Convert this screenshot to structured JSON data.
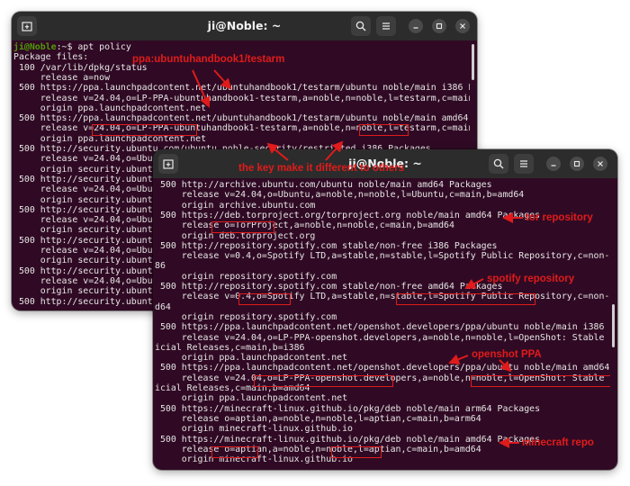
{
  "back_window": {
    "title": "ji@Noble: ~",
    "prompt_user": "ji@Noble",
    "prompt_sep": ":~$",
    "command": " apt policy",
    "lines": [
      "Package files:",
      " 100 /var/lib/dpkg/status",
      "     release a=now",
      " 500 https://ppa.launchpadcontent.net/ubuntuhandbook1/testarm/ubuntu noble/main i386 Packages",
      "     release v=24.04,o=LP-PPA-ubuntuhandbook1-testarm,a=noble,n=noble,l=testarm,c=main,b=i386",
      "     origin ppa.launchpadcontent.net",
      " 500 https://ppa.launchpadcontent.net/ubuntuhandbook1/testarm/ubuntu noble/main amd64 Packages",
      "     release v=24.04,o=LP-PPA-ubuntuhandbook1-testarm,a=noble,n=noble,l=testarm,c=main,b=amd64",
      "     origin ppa.launchpadcontent.net",
      " 500 http://security.ubuntu.com/ubuntu noble-security/restricted i386 Packages",
      "     release v=24.04,o=Ubuntu",
      "     origin security.ubuntu.c",
      " 500 http://security.ubuntu.c",
      "     release v=24.04,o=Ubuntu",
      "     origin security.ubuntu.c",
      " 500 http://security.ubuntu.c",
      "     release v=24.04,o=Ubuntu",
      "     origin security.ubuntu.c",
      " 500 http://security.ubuntu.c",
      "     release v=24.04,o=Ubuntu",
      "     origin security.ubuntu.c",
      " 500 http://security.ubuntu.c",
      "     release v=24.04,o=Ubuntu",
      "     origin security.ubuntu.c",
      " 500 http://security.ubuntu.c"
    ]
  },
  "front_window": {
    "title": "ji@Noble: ~",
    "lines": [
      " 500 http://archive.ubuntu.com/ubuntu noble/main amd64 Packages",
      "     release v=24.04,o=Ubuntu,a=noble,n=noble,l=Ubuntu,c=main,b=amd64",
      "     origin archive.ubuntu.com",
      " 500 https://deb.torproject.org/torproject.org noble/main amd64 Packages",
      "     release o=TorProject,a=noble,n=noble,c=main,b=amd64",
      "     origin deb.torproject.org",
      " 500 http://repository.spotify.com stable/non-free i386 Packages",
      "     release v=0.4,o=Spotify LTD,a=stable,n=stable,l=Spotify Public Repository,c=non-free,b=i3",
      "86",
      "     origin repository.spotify.com",
      " 500 http://repository.spotify.com stable/non-free amd64 Packages",
      "     release v=0.4,o=Spotify LTD,a=stable,n=stable,l=Spotify Public Repository,c=non-free,b=am",
      "d64",
      "     origin repository.spotify.com",
      " 500 https://ppa.launchpadcontent.net/openshot.developers/ppa/ubuntu noble/main i386 Packages",
      "     release v=24.04,o=LP-PPA-openshot.developers,a=noble,n=noble,l=OpenShot: Stable PPA - Off",
      "icial Releases,c=main,b=i386",
      "     origin ppa.launchpadcontent.net",
      " 500 https://ppa.launchpadcontent.net/openshot.developers/ppa/ubuntu noble/main amd64 Packages",
      "     release v=24.04,o=LP-PPA-openshot.developers,a=noble,n=noble,l=OpenShot: Stable PPA - Off",
      "icial Releases,c=main,b=amd64",
      "     origin ppa.launchpadcontent.net",
      " 500 https://minecraft-linux.github.io/pkg/deb noble/main arm64 Packages",
      "     release o=aptian,a=noble,n=noble,l=aptian,c=main,b=arm64",
      "     origin minecraft-linux.github.io",
      " 500 https://minecraft-linux.github.io/pkg/deb noble/main amd64 Packages",
      "     release o=aptian,a=noble,n=noble,l=aptian,c=main,b=amd64",
      "     origin minecraft-linux.github.io"
    ]
  },
  "annotations": {
    "ppa_label": "ppa:ubuntuhandbook1/testarm",
    "key_note": "the key make it different to others",
    "tor": "tor repository",
    "spotify": "spotify repository",
    "openshot": "openshot PPA",
    "minecraft": "minecraft repo"
  },
  "colors": {
    "terminal_bg": "#300a24",
    "titlebar_bg": "#2c2c2c",
    "annotation_red": "#e01b1b"
  },
  "icons": {
    "new_tab": "new-tab-icon",
    "search": "search-icon",
    "menu": "hamburger-menu-icon",
    "minimize": "minimize-icon",
    "maximize": "maximize-icon",
    "close": "close-icon"
  }
}
